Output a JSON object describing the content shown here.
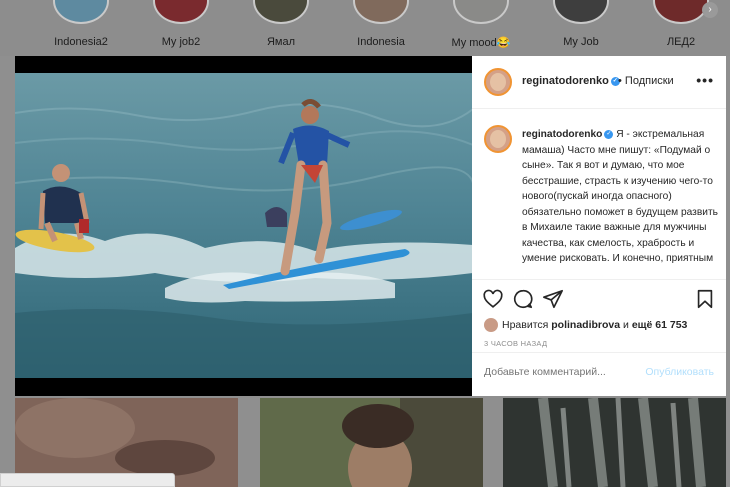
{
  "stories": [
    {
      "label": "Indonesia2"
    },
    {
      "label": "My job2"
    },
    {
      "label": "Ямал"
    },
    {
      "label": "Indonesia"
    },
    {
      "label": "My mood😂"
    },
    {
      "label": "My Job"
    },
    {
      "label": "ЛЕД2"
    }
  ],
  "post": {
    "header": {
      "username": "reginatodorenko",
      "separator": "•",
      "follow_label": "Подписки",
      "more_icon": "more-dots-icon"
    },
    "caption": {
      "username": "reginatodorenko",
      "text": "Я - экстремальная мамаша) Часто мне пишут: «Подумай о сыне». Так я вот и думаю, что мое бесстрашие, страсть к изучению чего-то нового(пускай иногда опасного) обязательно поможет в будущем развить в Михаиле такие важные для мужчины качества, как смелость, храбрость и умение рисковать. И конечно, приятным"
    },
    "actions": {
      "icons": [
        "heart-icon",
        "comment-icon",
        "share-icon",
        "bookmark-icon"
      ]
    },
    "likes": {
      "prefix": "Нравится",
      "liker": "polinadibrova",
      "conjunction": "и",
      "more": "ещё 61 753"
    },
    "time": "3 ЧАСОВ НАЗАД",
    "comment": {
      "placeholder": "Добавьте комментарий...",
      "publish_label": "Опубликовать"
    }
  },
  "colors": {
    "accent": "#3897f0",
    "publish_disabled": "#b2dffc",
    "overlay": "#8f8f8f"
  }
}
